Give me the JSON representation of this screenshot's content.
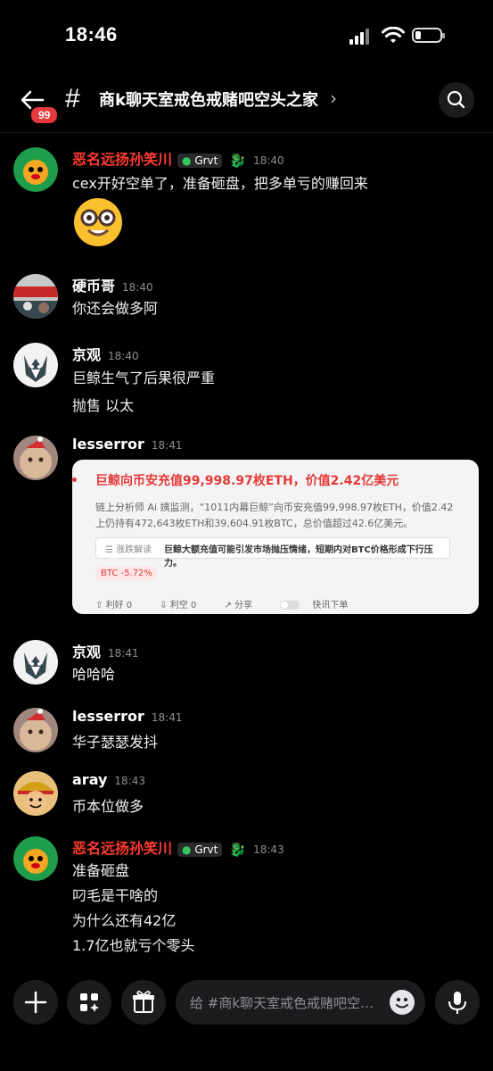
{
  "status": {
    "time": "18:46"
  },
  "header": {
    "badge": "99",
    "hash": "#",
    "title": "商k聊天室戒色戒赌吧空头之家",
    "chevron": "›"
  },
  "messages": [
    {
      "name": "恶名远扬孙笑川",
      "tag": "Grvt",
      "time": "18:40",
      "lines": [
        "cex开好空单了，准备砸盘，把多单亏的赚回来"
      ]
    },
    {
      "name": "硬币哥",
      "time": "18:40",
      "lines": [
        "你还会做多阿"
      ]
    },
    {
      "name": "京观",
      "time": "18:40",
      "lines": [
        "巨鲸生气了后果很严重",
        "抛售 以太"
      ]
    },
    {
      "name": "lesserror",
      "time": "18:41"
    },
    {
      "name": "京观",
      "time": "18:41",
      "lines": [
        "哈哈哈"
      ]
    },
    {
      "name": "lesserror",
      "time": "18:41",
      "lines": [
        "华子瑟瑟发抖"
      ]
    },
    {
      "name": "aray",
      "time": "18:43",
      "lines": [
        "币本位做多"
      ]
    },
    {
      "name": "恶名远扬孙笑川",
      "tag": "Grvt",
      "time": "18:43",
      "lines": [
        "准备砸盘",
        "叼毛是干啥的",
        "为什么还有42亿",
        "1.7亿也就亏个零头"
      ]
    }
  ],
  "news": {
    "headline": "巨鲸向币安充值99,998.97枚ETH，价值2.42亿美元",
    "body1": "链上分析师 Ai 姨监测，“1011内幕巨鲸”向币安充值99,998.97枚ETH，价值2.42",
    "body2": "上仍持有472,643枚ETH和39,604.91枚BTC，总价值超过42.6亿美元。",
    "interp_label": "☰ 涨跌解读",
    "interp_text": "巨鲸大额充值可能引发市场抛压情绪，短期内对BTC价格形成下行压力。",
    "pill": "BTC -5.72%",
    "bull": "利好 0",
    "bear": "利空 0",
    "share": "分享",
    "quick": "快讯下单"
  },
  "input": {
    "placeholder": "给 #商k聊天室戒色戒赌吧空头之家发消息"
  }
}
